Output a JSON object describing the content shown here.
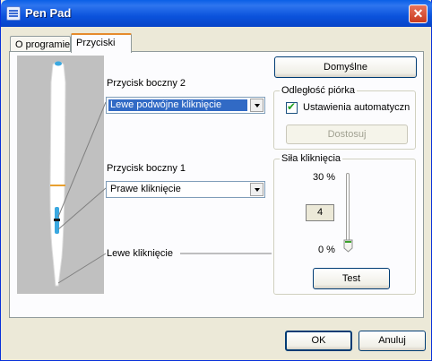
{
  "window": {
    "title": "Pen Pad"
  },
  "tabs": [
    {
      "label": "O programie",
      "active": false
    },
    {
      "label": "Przyciski",
      "active": true
    }
  ],
  "buttons_config": {
    "side2": {
      "label": "Przycisk boczny 2",
      "value": "Lewe podwójne kliknięcie"
    },
    "side1": {
      "label": "Przycisk boczny 1",
      "value": "Prawe kliknięcie"
    },
    "tip": {
      "label": "Lewe kliknięcie"
    }
  },
  "defaults_button": "Domyślne",
  "distance": {
    "title": "Odległość piórka",
    "auto_label": "Ustawienia automatyczn",
    "auto_checked": true,
    "adjust_button": "Dostosuj"
  },
  "click_force": {
    "title": "Siła kliknięcia",
    "max_label": "30 %",
    "min_label": "0 %",
    "value": "4",
    "slider_level": 0,
    "test_button": "Test"
  },
  "footer": {
    "ok": "OK",
    "cancel": "Anuluj"
  },
  "colors": {
    "title_blue": "#0a5fe6",
    "pen_accent_blue": "#3aa8e0",
    "pen_band_orange": "#e8a030",
    "selection_blue": "#316ac5"
  },
  "icons": [
    "app-icon",
    "close-icon",
    "dropdown-arrow-icon",
    "checkmark-icon"
  ]
}
